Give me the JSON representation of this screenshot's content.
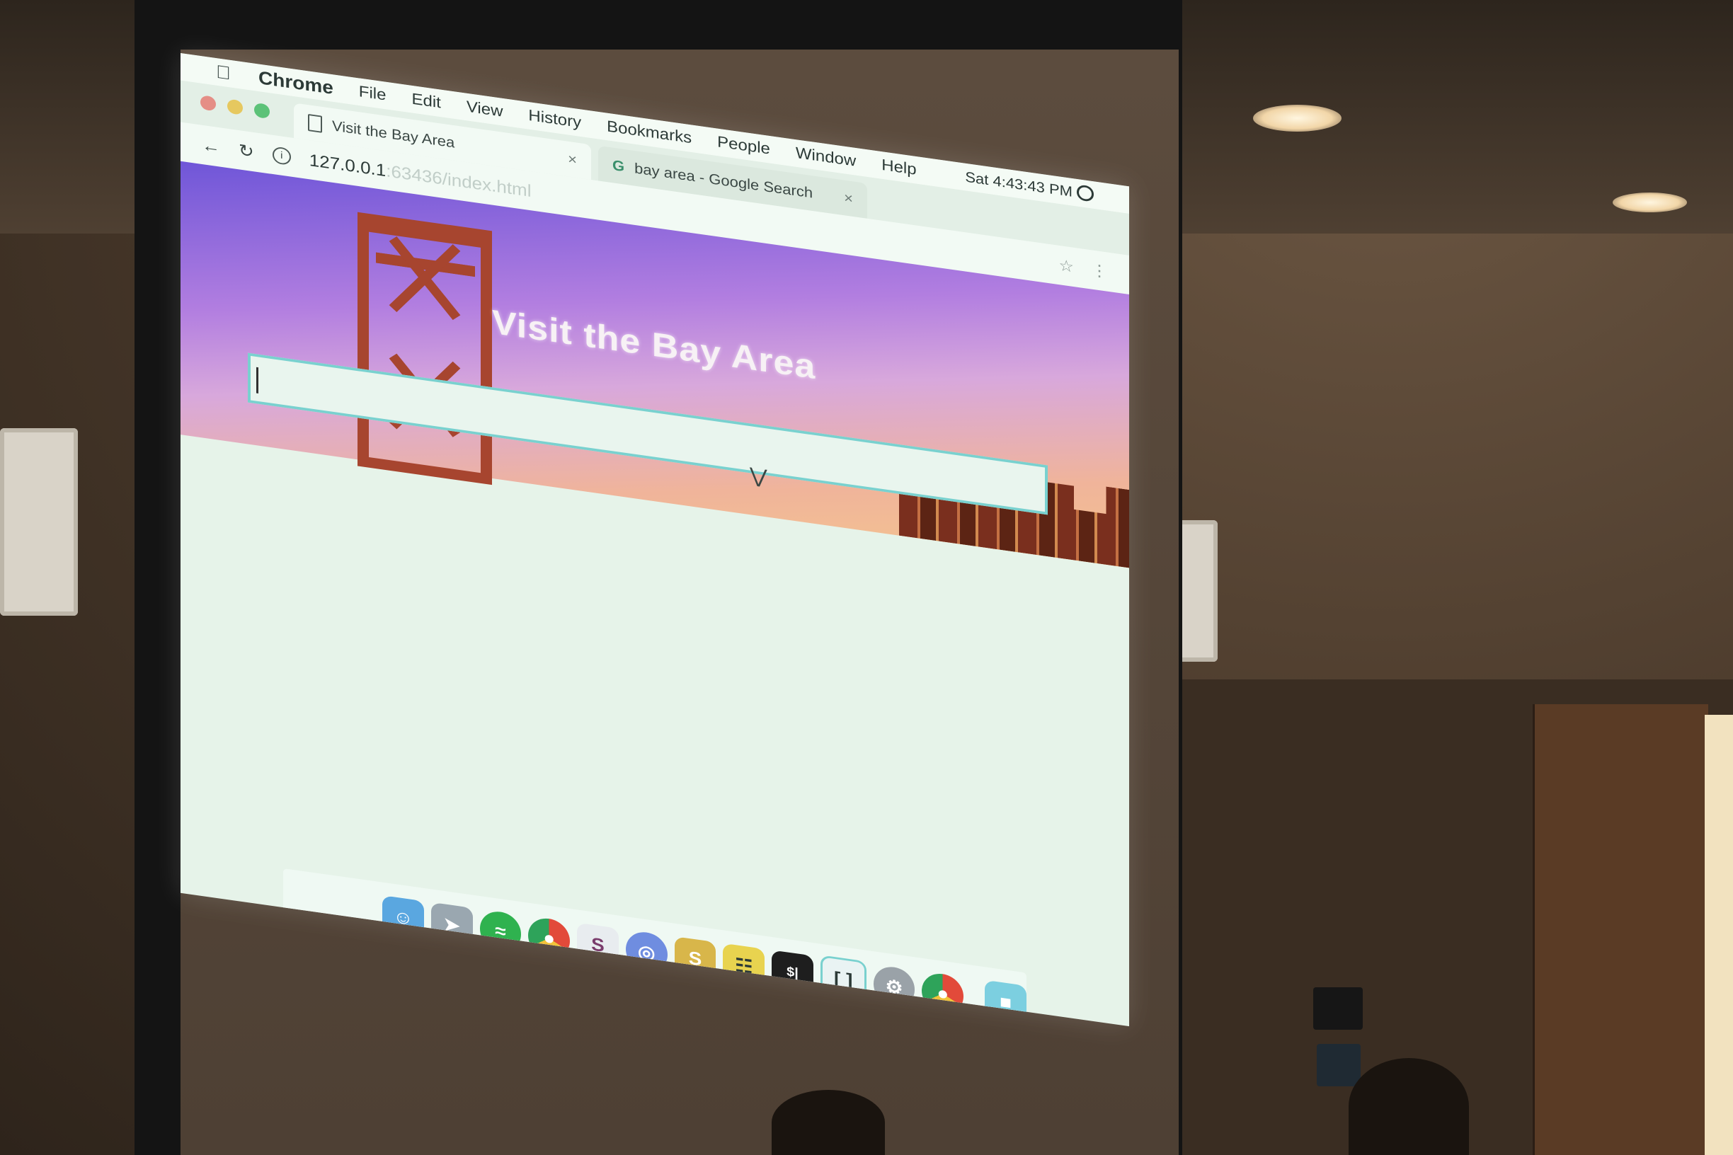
{
  "menubar": {
    "app_name": "Chrome",
    "items": [
      "File",
      "Edit",
      "View",
      "History",
      "Bookmarks",
      "People",
      "Window",
      "Help"
    ],
    "clock": "Sat 4:43:43 PM"
  },
  "tabs": [
    {
      "title": "Visit the Bay Area",
      "icon": "document-icon",
      "active": true
    },
    {
      "title": "bay area - Google Search",
      "icon": "google-icon",
      "active": false
    }
  ],
  "urlbar": {
    "host": "127.0.0.1",
    "path": ":63436/index.html"
  },
  "page": {
    "title": "Visit the Bay Area",
    "search_value": ""
  },
  "dock": {
    "items": [
      "finder",
      "launchpad",
      "spotify",
      "chrome",
      "slack",
      "discord",
      "sequel-pro",
      "database",
      "terminal",
      "brackets",
      "system-preferences",
      "chrome",
      "folder"
    ]
  },
  "colors": {
    "hero_gradient_start": "#6f56d8",
    "hero_gradient_end": "#f4c58f",
    "search_border": "#79d1cf",
    "bridge": "#a7452f"
  }
}
